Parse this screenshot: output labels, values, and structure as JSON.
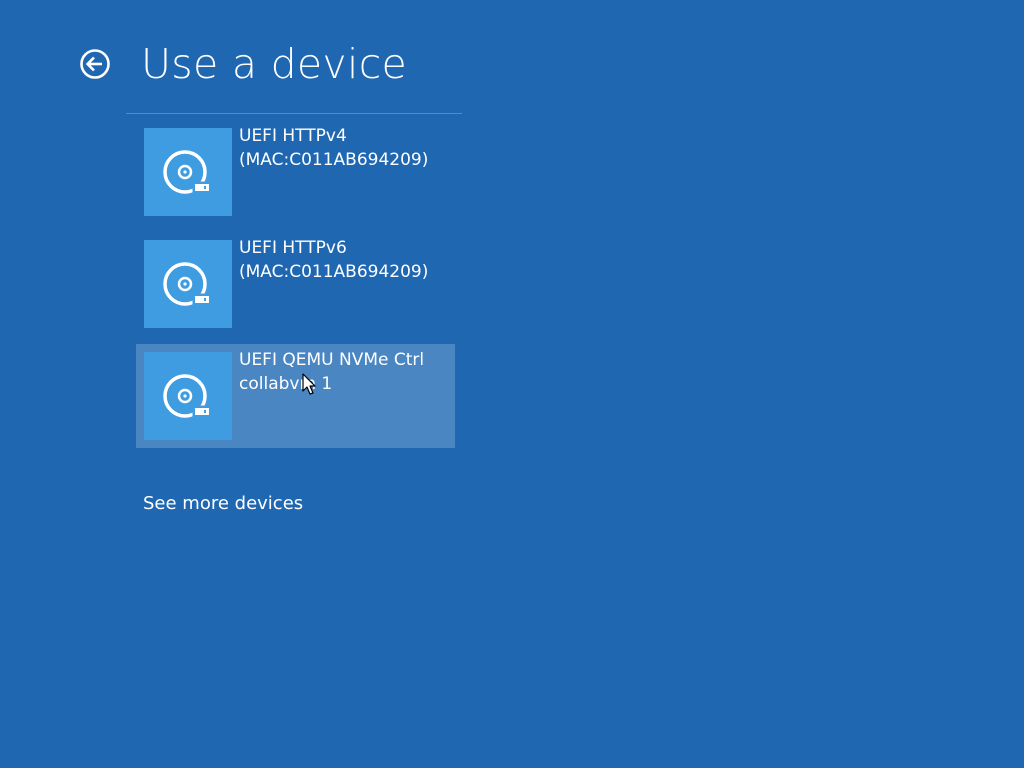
{
  "header": {
    "back_icon": "back-arrow-circle-icon",
    "title": "Use a device"
  },
  "devices": [
    {
      "icon": "disc-drive-icon",
      "line1": "UEFI HTTPv4",
      "line2": "(MAC:C011AB694209)",
      "highlighted": false
    },
    {
      "icon": "disc-drive-icon",
      "line1": "UEFI HTTPv6",
      "line2": "(MAC:C011AB694209)",
      "highlighted": false
    },
    {
      "icon": "disc-drive-icon",
      "line1": "UEFI QEMU NVMe Ctrl",
      "line2": "collabvm 1",
      "highlighted": true
    }
  ],
  "footer": {
    "see_more_label": "See more devices"
  },
  "colors": {
    "background": "#2067b2",
    "tile_icon_bg": "#3f9ce0",
    "tile_hover_bg": "#4a86c2",
    "text": "#ffffff"
  }
}
